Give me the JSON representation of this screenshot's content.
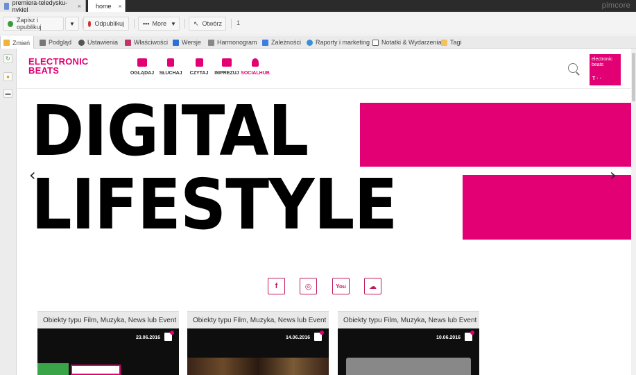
{
  "doc_tabs": [
    {
      "label": "premiera-teledysku-nykiel",
      "close": "×"
    },
    {
      "label": "home",
      "close": "×"
    }
  ],
  "brand": "pimcore",
  "toolbar": {
    "save_publish": "Zapisz i opublikuj",
    "unpublish": "Odpublikuj",
    "more": "More",
    "open": "Otwórz",
    "count": "1"
  },
  "subtabs": [
    {
      "label": "Zmień",
      "icon": "pencil-icon"
    },
    {
      "label": "Podgląd",
      "icon": "preview-icon"
    },
    {
      "label": "Ustawienia",
      "icon": "gear-icon"
    },
    {
      "label": "Właściwości",
      "icon": "properties-icon"
    },
    {
      "label": "Wersje",
      "icon": "versions-icon"
    },
    {
      "label": "Harmonogram",
      "icon": "schedule-icon"
    },
    {
      "label": "Zależności",
      "icon": "dependencies-icon"
    },
    {
      "label": "Raporty i marketing",
      "icon": "reports-icon"
    },
    {
      "label": "Notatki & Wydarzenia",
      "icon": "notes-icon"
    },
    {
      "label": "Tagi",
      "icon": "tag-icon"
    }
  ],
  "site": {
    "logo": "ELECTRONIC BEATS",
    "nav": [
      {
        "label": "OGLĄDAJ",
        "icon": "camera-icon"
      },
      {
        "label": "SŁUCHAJ",
        "icon": "music-note-icon"
      },
      {
        "label": "CZYTAJ",
        "icon": "document-icon"
      },
      {
        "label": "IMPREZUJ",
        "icon": "calendar-icon"
      },
      {
        "label": "SOCIALHUB",
        "icon": "user-icon"
      }
    ],
    "badge_line1": "electronic",
    "badge_line2": "beats",
    "badge_t": "T · ·",
    "hero_line1": "DIGITAL",
    "hero_line2": "LIFESTYLE",
    "social": [
      {
        "label": "f",
        "icon": "facebook-icon"
      },
      {
        "label": "◎",
        "icon": "instagram-icon"
      },
      {
        "label": "You",
        "icon": "youtube-icon"
      },
      {
        "label": "☁",
        "icon": "soundcloud-icon"
      }
    ],
    "cards": [
      {
        "title": "Obiekty typu Film, Muzyka, News lub Event",
        "date": "23.06.2016"
      },
      {
        "title": "Obiekty typu Film, Muzyka, News lub Event",
        "date": "14.06.2016"
      },
      {
        "title": "Obiekty typu Film, Muzyka, News lub Event",
        "date": "10.06.2016"
      }
    ]
  },
  "colors": {
    "accent": "#e20074",
    "dark": "#2b2b2b"
  }
}
